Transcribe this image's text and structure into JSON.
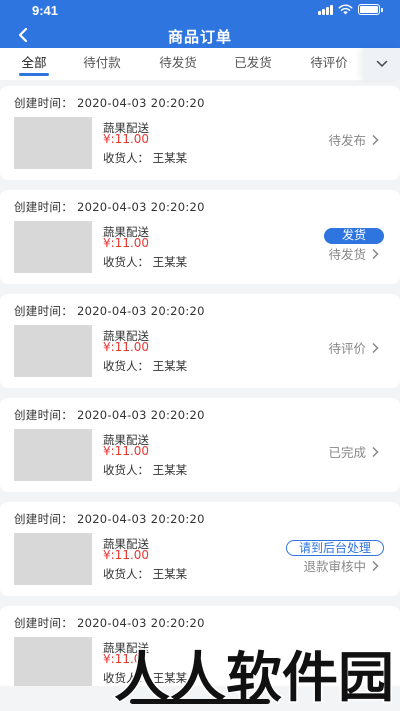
{
  "status_bar": {
    "time": "9:41"
  },
  "header": {
    "title": "商品订单"
  },
  "tabs": [
    {
      "label": "全部",
      "active": true
    },
    {
      "label": "待付款",
      "active": false
    },
    {
      "label": "待发货",
      "active": false
    },
    {
      "label": "已发货",
      "active": false
    },
    {
      "label": "待评价",
      "active": false
    }
  ],
  "orders": [
    {
      "created": "创建时间：  2020-04-03 20:20:20",
      "product": "蔬果配送",
      "price": "¥:11.00",
      "receiver": "收货人：  王某某",
      "status": "待发布",
      "action": ""
    },
    {
      "created": "创建时间：  2020-04-03 20:20:20",
      "product": "蔬果配送",
      "price": "¥:11.00",
      "receiver": "收货人：  王某某",
      "status": "待发货",
      "action": "发货"
    },
    {
      "created": "创建时间：  2020-04-03 20:20:20",
      "product": "蔬果配送",
      "price": "¥:11.00",
      "receiver": "收货人：  王某某",
      "status": "待评价",
      "action": ""
    },
    {
      "created": "创建时间：  2020-04-03 20:20:20",
      "product": "蔬果配送",
      "price": "¥:11.00",
      "receiver": "收货人：  王某某",
      "status": "已完成",
      "action": ""
    },
    {
      "created": "创建时间：  2020-04-03 20:20:20",
      "product": "蔬果配送",
      "price": "¥:11.00",
      "receiver": "收货人：  王某某",
      "status": "退款审核中",
      "action": "请到后台处理"
    },
    {
      "created": "创建时间：  2020-04-03 20:20:20",
      "product": "蔬果配送",
      "price": "¥:11.0",
      "receiver": "收货人：  王某某",
      "status": "",
      "action": ""
    }
  ],
  "watermark": {
    "text": "人人软件园"
  },
  "colors": {
    "brand": "#2f75e0",
    "price": "#e8382f",
    "status_text": "#888888",
    "background": "#f3f4f6"
  }
}
